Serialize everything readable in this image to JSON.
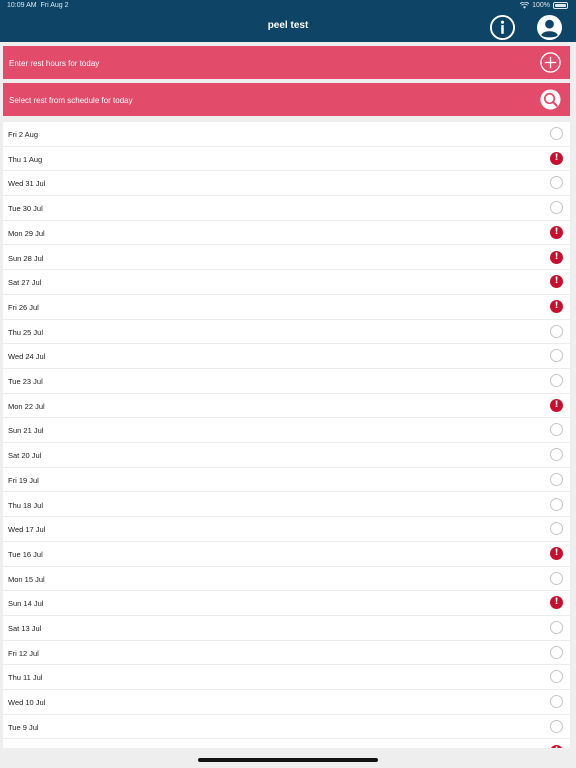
{
  "status_bar": {
    "time": "10:09 AM",
    "date": "Fri Aug 2",
    "battery": "100%"
  },
  "header": {
    "title": "peel test",
    "info_icon": "info-icon",
    "user_icon": "user-icon"
  },
  "colors": {
    "header": "#0e4466",
    "action": "#e34b6a",
    "warning": "#c8102e"
  },
  "actions": [
    {
      "label": "Enter rest hours for today",
      "icon": "plus-icon"
    },
    {
      "label": "Select rest from schedule for today",
      "icon": "search-icon"
    }
  ],
  "days": [
    {
      "date": "Fri 2 Aug",
      "status": "empty"
    },
    {
      "date": "Thu 1 Aug",
      "status": "warning"
    },
    {
      "date": "Wed 31 Jul",
      "status": "empty"
    },
    {
      "date": "Tue 30 Jul",
      "status": "empty"
    },
    {
      "date": "Mon 29 Jul",
      "status": "warning"
    },
    {
      "date": "Sun 28 Jul",
      "status": "warning"
    },
    {
      "date": "Sat 27 Jul",
      "status": "warning"
    },
    {
      "date": "Fri 26 Jul",
      "status": "warning"
    },
    {
      "date": "Thu 25 Jul",
      "status": "empty"
    },
    {
      "date": "Wed 24 Jul",
      "status": "empty"
    },
    {
      "date": "Tue 23 Jul",
      "status": "empty"
    },
    {
      "date": "Mon 22 Jul",
      "status": "warning"
    },
    {
      "date": "Sun 21 Jul",
      "status": "empty"
    },
    {
      "date": "Sat 20 Jul",
      "status": "empty"
    },
    {
      "date": "Fri 19 Jul",
      "status": "empty"
    },
    {
      "date": "Thu 18 Jul",
      "status": "empty"
    },
    {
      "date": "Wed 17 Jul",
      "status": "empty"
    },
    {
      "date": "Tue 16 Jul",
      "status": "warning"
    },
    {
      "date": "Mon 15 Jul",
      "status": "empty"
    },
    {
      "date": "Sun 14 Jul",
      "status": "warning"
    },
    {
      "date": "Sat 13 Jul",
      "status": "empty"
    },
    {
      "date": "Fri 12 Jul",
      "status": "empty"
    },
    {
      "date": "Thu 11 Jul",
      "status": "empty"
    },
    {
      "date": "Wed 10 Jul",
      "status": "empty"
    },
    {
      "date": "Tue 9 Jul",
      "status": "empty"
    },
    {
      "date": "",
      "status": "warning"
    }
  ]
}
